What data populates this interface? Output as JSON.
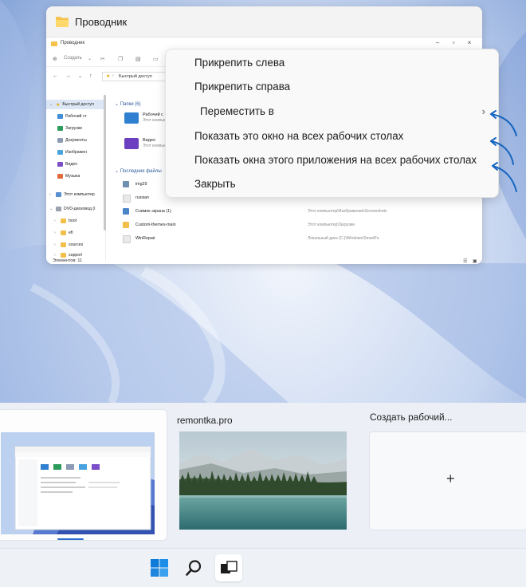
{
  "window": {
    "title": "Проводник",
    "icon": "folder-icon"
  },
  "explorer": {
    "title": "Проводник",
    "toolbar": {
      "create_label": "Создать"
    },
    "address": "Быстрый доступ",
    "sidebar": [
      {
        "label": "Быстрый доступ",
        "icon": "star-icon",
        "selected": true
      },
      {
        "label": "Рабочий ст",
        "icon": "desktop-icon"
      },
      {
        "label": "Загрузки",
        "icon": "download-icon"
      },
      {
        "label": "Документы",
        "icon": "documents-icon"
      },
      {
        "label": "Изображен",
        "icon": "pictures-icon"
      },
      {
        "label": "Видео",
        "icon": "video-icon"
      },
      {
        "label": "Музыка",
        "icon": "music-icon"
      },
      {
        "label": "Этот компьютер",
        "icon": "pc-icon"
      },
      {
        "label": "DVD-дисковод (I",
        "icon": "dvd-icon"
      },
      {
        "label": "boot",
        "icon": "folder-icon"
      },
      {
        "label": "efi",
        "icon": "folder-icon"
      },
      {
        "label": "sources",
        "icon": "folder-icon"
      },
      {
        "label": "support",
        "icon": "folder-icon"
      }
    ],
    "folders_header": "Папки (6)",
    "folders": [
      {
        "name": "Рабочий с",
        "sub": "Этот компьюте"
      },
      {
        "name": "Видео",
        "sub": "Этот компьюте"
      }
    ],
    "recent_header": "Последние файлы",
    "recent": [
      {
        "name": "img29",
        "path": ""
      },
      {
        "name": "russian",
        "path": ""
      },
      {
        "name": "Снимок экрана (1)",
        "path": "Этот компьютер\\Изображения\\Screenshots"
      },
      {
        "name": "Custom-themes-main",
        "path": "Этот компьютер\\Загрузки"
      },
      {
        "name": "WinRepair",
        "path": "Локальный диск (C:)\\Windows\\SmartFo"
      }
    ],
    "status": "Элементов: 11"
  },
  "context_menu": {
    "items": [
      "Прикрепить слева",
      "Прикрепить справа",
      "Переместить в",
      "Показать это окно на всех рабочих столах",
      "Показать окна этого приложения на всех рабочих столах",
      "Закрыть"
    ]
  },
  "desktops": {
    "items": [
      {
        "label": "",
        "active": true
      },
      {
        "label": "remontka.pro",
        "active": false
      }
    ],
    "new_label": "Создать рабочий..."
  },
  "taskbar": {
    "items": [
      "windows-start-icon",
      "search-icon",
      "task-view-icon"
    ]
  },
  "colors": {
    "accent": "#1a73c9",
    "annotation_arrow": "#1565c0",
    "menu_bg": "#f9f9f9",
    "taskbar_bg": "#eef1f6"
  }
}
